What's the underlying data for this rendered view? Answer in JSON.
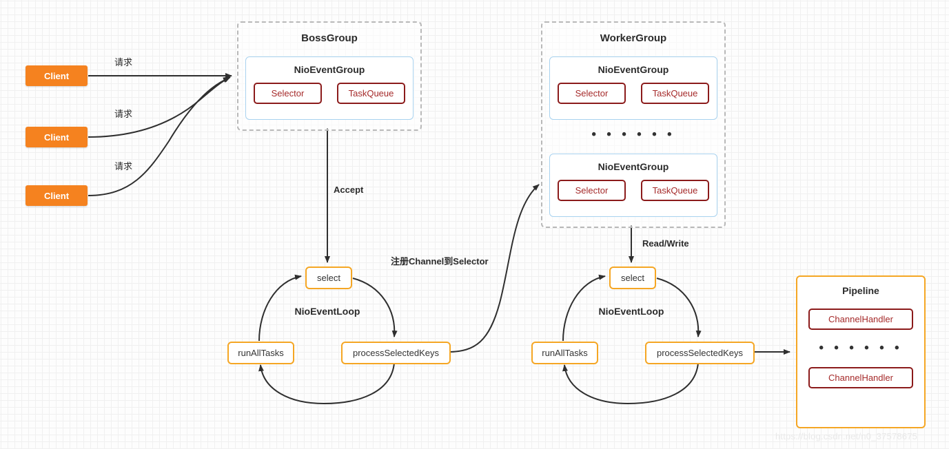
{
  "diagram": {
    "clients": [
      {
        "label": "Client"
      },
      {
        "label": "Client"
      },
      {
        "label": "Client"
      }
    ],
    "boss_group": {
      "title": "BossGroup",
      "event_group": {
        "title": "NioEventGroup",
        "selector": "Selector",
        "task_queue": "TaskQueue"
      }
    },
    "worker_group": {
      "title": "WorkerGroup",
      "separator": "• • • • • •",
      "event_groups": [
        {
          "title": "NioEventGroup",
          "selector": "Selector",
          "task_queue": "TaskQueue"
        },
        {
          "title": "NioEventGroup",
          "selector": "Selector",
          "task_queue": "TaskQueue"
        }
      ]
    },
    "boss_loop": {
      "title": "NioEventLoop",
      "select": "select",
      "process_selected_keys": "processSelectedKeys",
      "run_all_tasks": "runAllTasks"
    },
    "worker_loop": {
      "title": "NioEventLoop",
      "select": "select",
      "process_selected_keys": "processSelectedKeys",
      "run_all_tasks": "runAllTasks"
    },
    "pipeline": {
      "title": "Pipeline",
      "separator": "• • • • • •",
      "handlers": [
        {
          "label": "ChannelHandler"
        },
        {
          "label": "ChannelHandler"
        }
      ]
    },
    "edge_labels": {
      "request_1": "请求",
      "request_2": "请求",
      "request_3": "请求",
      "accept": "Accept",
      "register_channel": "注册Channel到Selector",
      "read_write": "Read/Write"
    },
    "watermark": "https://blog.csdn.net/n0_37578675"
  }
}
